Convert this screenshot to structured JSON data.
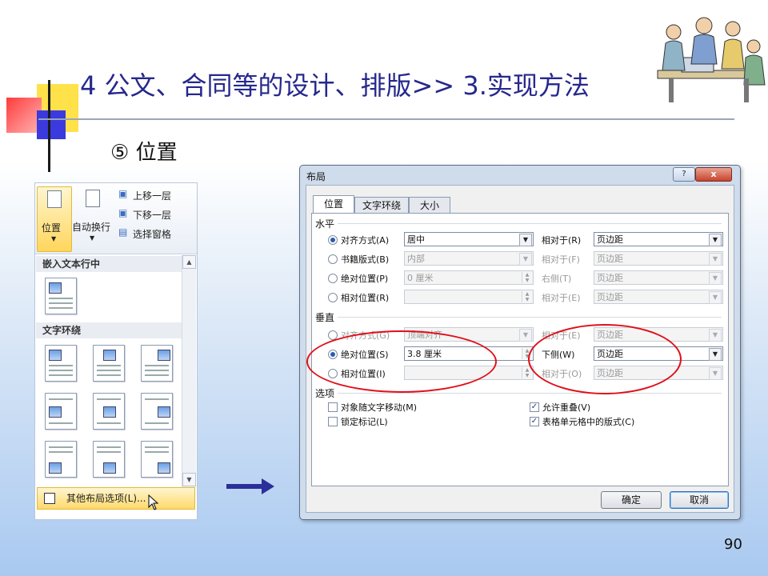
{
  "slide": {
    "title": "4 公文、合同等的设计、排版>> 3.实现方法",
    "subtitle": "⑤ 位置",
    "page_number": "90",
    "colors": {
      "title": "#26288c",
      "accent_red": "#e0101a",
      "arrow": "#2b2f9a"
    }
  },
  "ribbon": {
    "position_button": "位置",
    "wrap_button": "自动换行",
    "bring_forward": "上移一层",
    "send_backward": "下移一层",
    "selection_pane": "选择窗格",
    "gallery_inline_header": "嵌入文本行中",
    "gallery_wrap_header": "文字环绕",
    "more_layout_options": "其他布局选项(L)..."
  },
  "dialog": {
    "title": "布局",
    "help_glyph": "?",
    "close_glyph": "x",
    "tabs": [
      {
        "label": "位置",
        "active": true
      },
      {
        "label": "文字环绕",
        "active": false
      },
      {
        "label": "大小",
        "active": false
      }
    ],
    "horizontal": {
      "section": "水平",
      "rows": [
        {
          "label": "对齐方式(A)",
          "selected": true,
          "value": "居中",
          "rel_label": "相对于(R)",
          "rel_value": "页边距",
          "enabled": true
        },
        {
          "label": "书籍版式(B)",
          "selected": false,
          "value": "内部",
          "rel_label": "相对于(F)",
          "rel_value": "页边距",
          "enabled": false
        },
        {
          "label": "绝对位置(P)",
          "selected": false,
          "value": "0 厘米",
          "rel_label": "右侧(T)",
          "rel_value": "页边距",
          "enabled": false
        },
        {
          "label": "相对位置(R)",
          "selected": false,
          "value": "",
          "rel_label": "相对于(E)",
          "rel_value": "页边距",
          "enabled": false
        }
      ]
    },
    "vertical": {
      "section": "垂直",
      "rows": [
        {
          "label": "对齐方式(G)",
          "selected": false,
          "value": "顶端对齐",
          "rel_label": "相对于(E)",
          "rel_value": "页边距",
          "enabled": false
        },
        {
          "label": "绝对位置(S)",
          "selected": true,
          "value": "3.8 厘米",
          "rel_label": "下侧(W)",
          "rel_value": "页边距",
          "enabled": true
        },
        {
          "label": "相对位置(I)",
          "selected": false,
          "value": "",
          "rel_label": "相对于(O)",
          "rel_value": "页边距",
          "enabled": false
        }
      ]
    },
    "options": {
      "section": "选项",
      "move_with_text": {
        "label": "对象随文字移动(M)",
        "checked": false
      },
      "lock_anchor": {
        "label": "锁定标记(L)",
        "checked": false
      },
      "allow_overlap": {
        "label": "允许重叠(V)",
        "checked": true
      },
      "layout_in_cell": {
        "label": "表格单元格中的版式(C)",
        "checked": true
      }
    },
    "ok": "确定",
    "cancel": "取消"
  }
}
